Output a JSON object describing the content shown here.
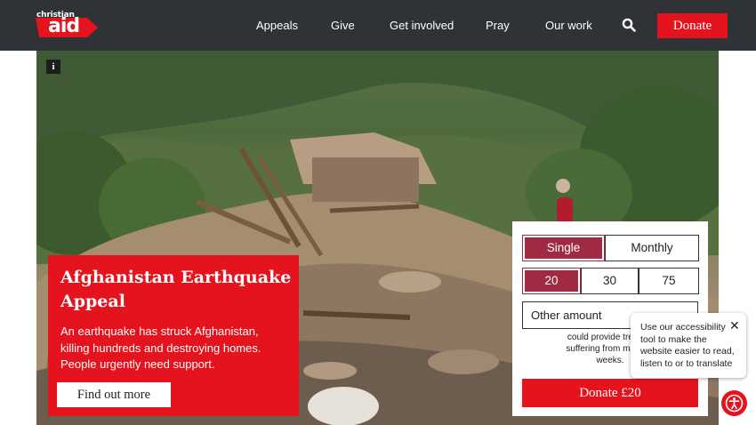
{
  "header": {
    "logo_small": "christian",
    "logo_big": "aid",
    "nav": [
      "Appeals",
      "Give",
      "Get involved",
      "Pray",
      "Our work"
    ],
    "donate_label": "Donate"
  },
  "hero": {
    "info_label": "i",
    "title": "Afghanistan Earthquake Appeal",
    "body": "An earthquake has struck Afghanistan, killing hundreds and destroying homes. People urgently need support.",
    "cta": "Find out more"
  },
  "donation": {
    "frequency": [
      "Single",
      "Monthly"
    ],
    "frequency_selected": "Single",
    "amounts": [
      "20",
      "30",
      "75"
    ],
    "amount_selected": "20",
    "other_placeholder": "Other amount",
    "impact_text": "could provide treatme... suffering from malnutri... weeks.",
    "impact_lines": [
      "could provide treatme",
      "suffering from malnutri",
      "weeks."
    ],
    "submit_label": "Donate £20"
  },
  "accessibility": {
    "tooltip": "Use our accessibility tool to make the website easier to read, listen to or to translate",
    "close_label": "✕"
  },
  "colors": {
    "nav_bg": "#2f3237",
    "brand_red": "#e4131d",
    "selected": "#a12a43"
  }
}
